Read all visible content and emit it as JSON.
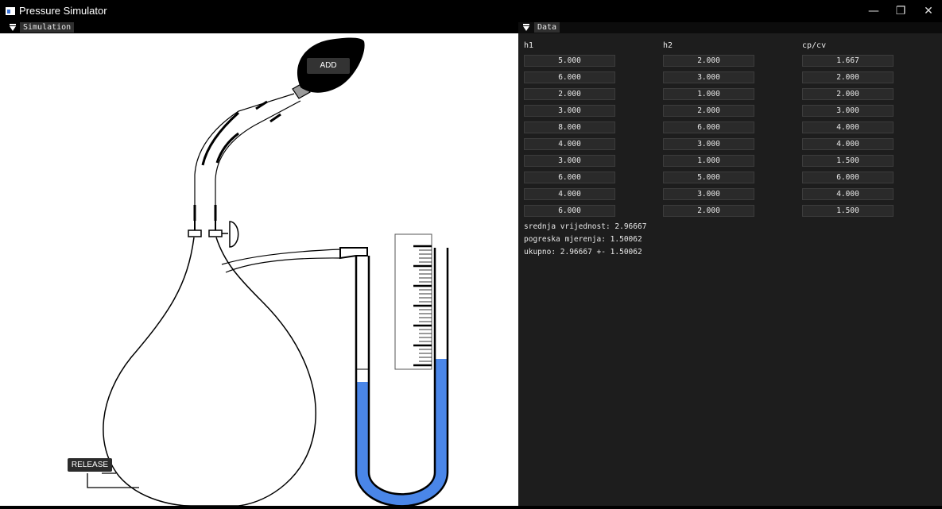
{
  "window": {
    "title": "Pressure Simulator",
    "minimize": "—",
    "maximize": "❐",
    "close": "✕"
  },
  "simulation": {
    "tab_label": "Simulation",
    "add_label": "ADD",
    "release_label": "RELEASE"
  },
  "data": {
    "tab_label": "Data",
    "columns": [
      "h1",
      "h2",
      "cp/cv"
    ],
    "rows": [
      [
        "5.000",
        "2.000",
        "1.667"
      ],
      [
        "6.000",
        "3.000",
        "2.000"
      ],
      [
        "2.000",
        "1.000",
        "2.000"
      ],
      [
        "3.000",
        "2.000",
        "3.000"
      ],
      [
        "8.000",
        "6.000",
        "4.000"
      ],
      [
        "4.000",
        "3.000",
        "4.000"
      ],
      [
        "3.000",
        "1.000",
        "1.500"
      ],
      [
        "6.000",
        "5.000",
        "6.000"
      ],
      [
        "4.000",
        "3.000",
        "4.000"
      ],
      [
        "6.000",
        "2.000",
        "1.500"
      ]
    ],
    "mean_text": "srednja vrijednost: 2.96667",
    "error_text": "pogreska mjerenja: 1.50062",
    "total_text": "ukupno: 2.96667 +- 1.50062"
  },
  "colors": {
    "fluid": "#4a86e8",
    "panel_bg": "#1d1d1d",
    "cell_bg": "#2a2a2a"
  }
}
